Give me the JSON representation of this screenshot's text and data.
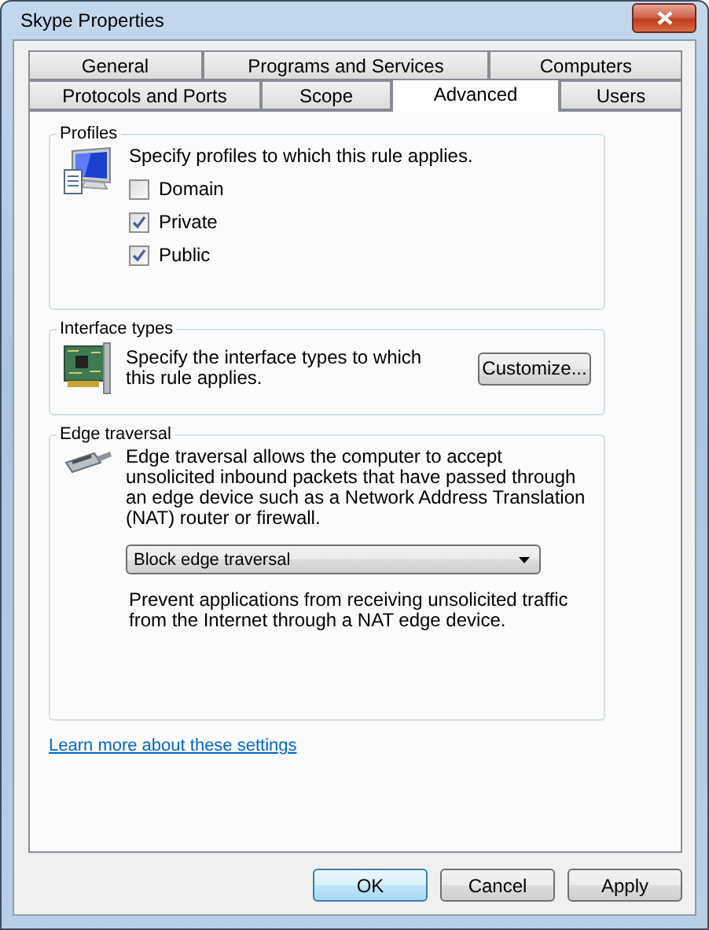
{
  "window": {
    "title": "Skype Properties"
  },
  "tab_rows": [
    [
      {
        "label": "General",
        "selected": false
      },
      {
        "label": "Programs and Services",
        "selected": false
      },
      {
        "label": "Computers",
        "selected": false
      }
    ],
    [
      {
        "label": "Protocols and Ports",
        "selected": false
      },
      {
        "label": "Scope",
        "selected": false
      },
      {
        "label": "Advanced",
        "selected": true
      },
      {
        "label": "Users",
        "selected": false
      }
    ]
  ],
  "profiles": {
    "title": "Profiles",
    "description": "Specify profiles to which this rule applies.",
    "options": [
      {
        "label": "Domain",
        "checked": false
      },
      {
        "label": "Private",
        "checked": true
      },
      {
        "label": "Public",
        "checked": true
      }
    ]
  },
  "interface_types": {
    "title": "Interface types",
    "description": "Specify the interface types to which this rule applies.",
    "button": "Customize..."
  },
  "edge_traversal": {
    "title": "Edge traversal",
    "description": "Edge traversal allows the computer to accept unsolicited inbound packets that have passed through an edge device such as a Network Address Translation (NAT) router or firewall.",
    "dropdown": {
      "value": "Block edge traversal"
    },
    "explanation": "Prevent applications from receiving unsolicited traffic from the Internet through a NAT edge device."
  },
  "link": "Learn more about these settings",
  "buttons": [
    {
      "label": "OK",
      "default": true
    },
    {
      "label": "Cancel",
      "default": false
    },
    {
      "label": "Apply",
      "default": false
    }
  ]
}
